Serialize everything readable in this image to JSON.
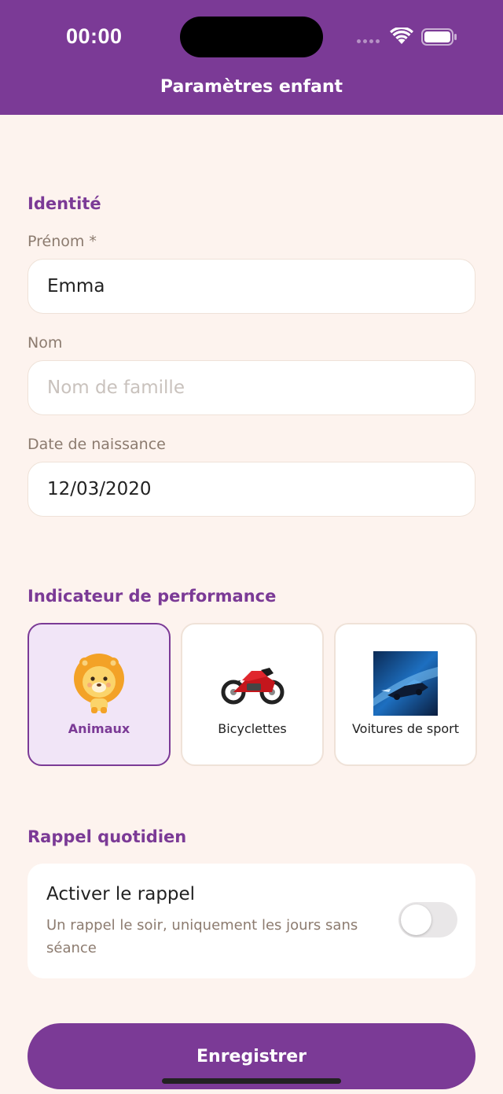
{
  "status_bar": {
    "time": "00:00"
  },
  "header": {
    "title": "Paramètres enfant"
  },
  "identity": {
    "section_title": "Identité",
    "first_name": {
      "label": "Prénom *",
      "value": "Emma"
    },
    "last_name": {
      "label": "Nom",
      "value": "",
      "placeholder": "Nom de famille"
    },
    "birth_date": {
      "label": "Date de naissance",
      "value": "12/03/2020"
    }
  },
  "performance": {
    "section_title": "Indicateur de performance",
    "options": [
      {
        "label": "Animaux",
        "icon": "lion-icon",
        "selected": true
      },
      {
        "label": "Bicyclettes",
        "icon": "motorcycle-icon",
        "selected": false
      },
      {
        "label": "Voitures de sport",
        "icon": "sports-car-icon",
        "selected": false
      }
    ]
  },
  "reminder": {
    "section_title": "Rappel quotidien",
    "title": "Activer le rappel",
    "description": "Un rappel le soir, uniquement les jours sans séance",
    "enabled": false
  },
  "actions": {
    "save_label": "Enregistrer"
  },
  "colors": {
    "accent": "#7b3a96",
    "background": "#fdf3ee"
  }
}
